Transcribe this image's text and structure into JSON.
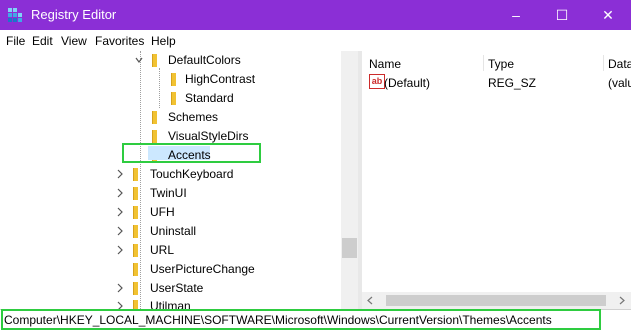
{
  "window": {
    "title": "Registry Editor"
  },
  "window_controls": {
    "minimize": "–",
    "maximize": "☐",
    "close": "✕"
  },
  "menu": [
    "File",
    "Edit",
    "View",
    "Favorites",
    "Help"
  ],
  "tree": {
    "items": [
      {
        "label": "DefaultColors",
        "expander": "open"
      },
      {
        "label": "HighContrast",
        "expander": "none"
      },
      {
        "label": "Standard",
        "expander": "none"
      },
      {
        "label": "Schemes",
        "expander": "none"
      },
      {
        "label": "VisualStyleDirs",
        "expander": "none"
      },
      {
        "label": "Accents",
        "expander": "none",
        "selected": true
      },
      {
        "label": "TouchKeyboard",
        "expander": "closed"
      },
      {
        "label": "TwinUI",
        "expander": "closed"
      },
      {
        "label": "UFH",
        "expander": "closed"
      },
      {
        "label": "Uninstall",
        "expander": "closed"
      },
      {
        "label": "URL",
        "expander": "closed"
      },
      {
        "label": "UserPictureChange",
        "expander": "none"
      },
      {
        "label": "UserState",
        "expander": "closed"
      },
      {
        "label": "Utilman",
        "expander": "closed"
      }
    ]
  },
  "list": {
    "columns": [
      "Name",
      "Type",
      "Data"
    ],
    "rows": [
      {
        "icon": "ab",
        "name": "(Default)",
        "type": "REG_SZ",
        "data": "(valu"
      }
    ]
  },
  "status": {
    "path": "Computer\\HKEY_LOCAL_MACHINE\\SOFTWARE\\Microsoft\\Windows\\CurrentVersion\\Themes\\Accents"
  },
  "colors": {
    "titlebar": "#8b2fd6",
    "highlight": "#2ecc40",
    "selection": "#cce8ff",
    "folder": "#f1c232"
  }
}
